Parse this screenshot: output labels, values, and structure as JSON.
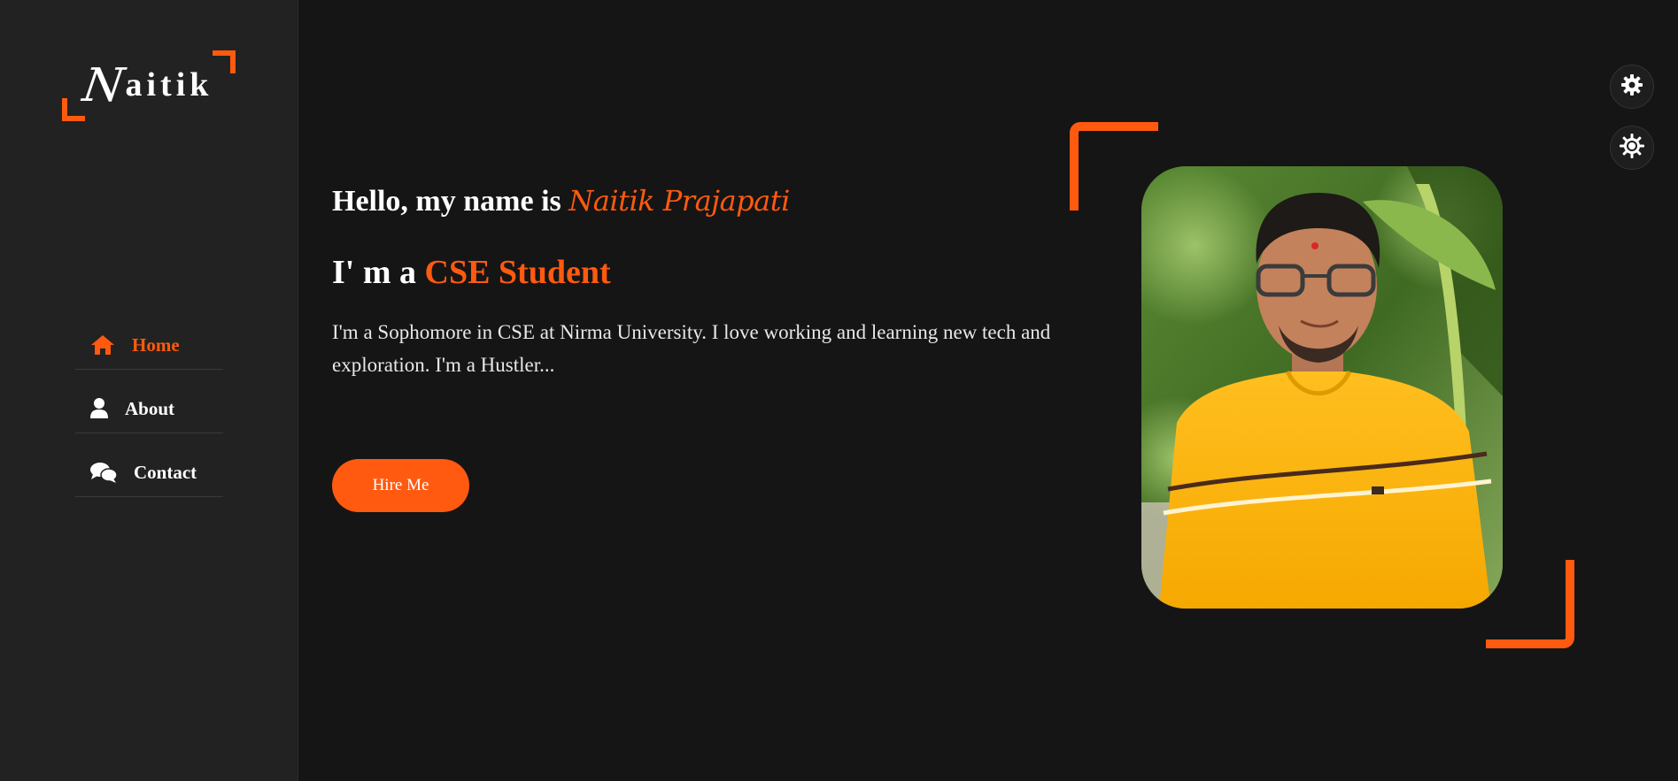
{
  "logo": {
    "first_letter": "N",
    "rest": "aitik"
  },
  "nav": {
    "items": [
      {
        "label": "Home",
        "icon": "home-icon",
        "active": true
      },
      {
        "label": "About",
        "icon": "user-icon",
        "active": false
      },
      {
        "label": "Contact",
        "icon": "chat-icon",
        "active": false
      }
    ]
  },
  "hero": {
    "greeting_prefix": "Hello, my name is ",
    "name": "Naitik Prajapati",
    "role_prefix": "I' m a ",
    "role": "CSE Student",
    "description": "I'm a Sophomore in CSE at Nirma University. I love working and learning new tech and exploration. I'm a Hustler...",
    "button_label": "Hire Me"
  },
  "photo": {
    "alt": "portrait-photo"
  },
  "controls": [
    {
      "icon": "gear-icon"
    },
    {
      "icon": "sun-icon"
    }
  ],
  "colors": {
    "accent": "#ff5a0f",
    "sidebar_bg": "#222222",
    "page_bg": "#151515"
  }
}
